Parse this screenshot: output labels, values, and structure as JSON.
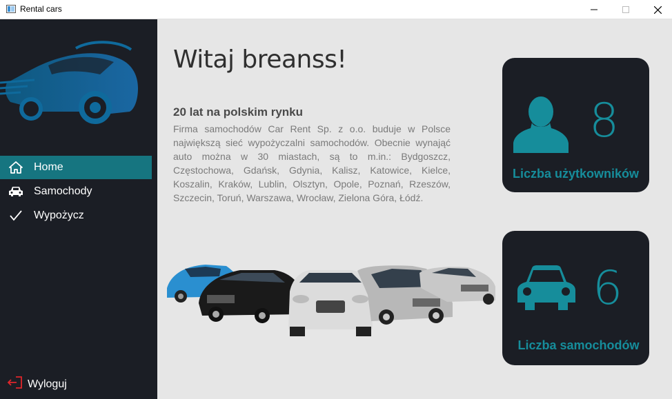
{
  "window": {
    "title": "Rental cars"
  },
  "sidebar": {
    "items": [
      {
        "label": "Home",
        "icon": "home-icon",
        "active": true
      },
      {
        "label": "Samochody",
        "icon": "car-icon",
        "active": false
      },
      {
        "label": "Wypożycz",
        "icon": "checkmark-icon",
        "active": false
      }
    ],
    "logout_label": "Wyloguj"
  },
  "main": {
    "welcome": "Witaj breanss!",
    "subtitle": "20 lat na polskim rynku",
    "description": "Firma samochodów Car Rent Sp. z o.o. buduje w Polsce największą sieć wypożyczalni samochodów. Obecnie wynająć auto można w 30 miastach, są to m.in.: Bydgoszcz, Częstochowa, Gdańsk, Gdynia, Kalisz, Katowice, Kielce, Koszalin, Kraków, Lublin, Olsztyn, Opole, Poznań, Rzeszów, Szczecin, Toruń, Warszawa, Wrocław, Zielona Góra, Łódź."
  },
  "stats": {
    "users": {
      "value": "8",
      "label": "Liczba użytkowników"
    },
    "cars": {
      "value": "6",
      "label": "Liczba samochodów"
    }
  },
  "colors": {
    "sidebar_bg": "#1b1e25",
    "accent": "#168d9b",
    "active_nav": "#167580",
    "logout_icon": "#e0262b"
  }
}
